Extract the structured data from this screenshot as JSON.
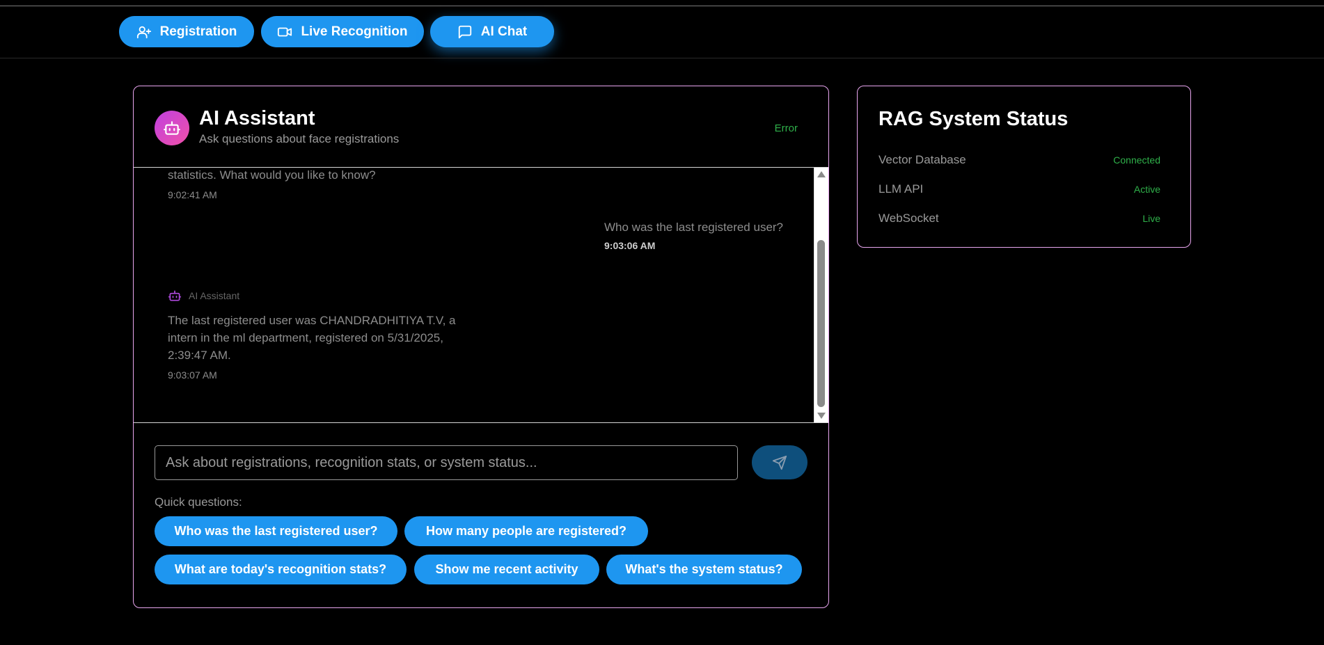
{
  "nav": {
    "tabs": [
      {
        "label": "Registration",
        "icon": "user-plus-icon"
      },
      {
        "label": "Live Recognition",
        "icon": "video-icon"
      },
      {
        "label": "AI Chat",
        "icon": "message-icon"
      }
    ],
    "active_tab": "AI Chat"
  },
  "chat": {
    "title": "AI Assistant",
    "subtitle": "Ask questions about face registrations",
    "status": "Error",
    "messages": [
      {
        "role": "assistant",
        "text": "statistics. What would you like to know?",
        "time": "9:02:41 AM"
      },
      {
        "role": "user",
        "text": "Who was the last registered user?",
        "time": "9:03:06 AM"
      },
      {
        "role": "assistant",
        "sender": "AI Assistant",
        "text_lines": [
          "The last registered user was CHANDRADHITIYA T.V, a",
          "intern in the ml department, registered on 5/31/2025,",
          "2:39:47 AM."
        ],
        "time": "9:03:07 AM"
      }
    ],
    "input_placeholder": "Ask about registrations, recognition stats, or system status...",
    "input_value": "",
    "quick_label": "Quick questions:",
    "quick_questions": [
      "Who was the last registered user?",
      "How many people are registered?",
      "What are today's recognition stats?",
      "Show me recent activity",
      "What's the system status?"
    ]
  },
  "rag": {
    "title": "RAG System Status",
    "items": [
      {
        "label": "Vector Database",
        "value": "Connected"
      },
      {
        "label": "LLM API",
        "value": "Active"
      },
      {
        "label": "WebSocket",
        "value": "Live"
      }
    ]
  },
  "colors": {
    "accent": "#1e96f0",
    "card_border": "#e9a6f0",
    "status_green": "#2fb04a",
    "send_button": "#0e4f7c",
    "background": "#000000"
  }
}
